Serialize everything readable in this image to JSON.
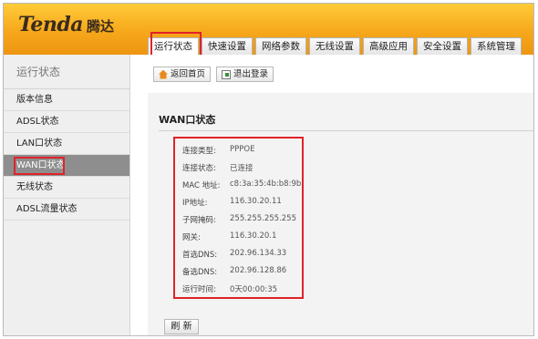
{
  "header": {
    "logo_en": "Tenda",
    "logo_cn": "腾达",
    "tabs": [
      {
        "label": "运行状态",
        "active": true
      },
      {
        "label": "快速设置",
        "active": false
      },
      {
        "label": "网络参数",
        "active": false
      },
      {
        "label": "无线设置",
        "active": false
      },
      {
        "label": "高级应用",
        "active": false
      },
      {
        "label": "安全设置",
        "active": false
      },
      {
        "label": "系统管理",
        "active": false
      }
    ]
  },
  "sidebar": {
    "title": "运行状态",
    "items": [
      {
        "label": "版本信息",
        "active": false
      },
      {
        "label": "ADSL状态",
        "active": false
      },
      {
        "label": "LAN口状态",
        "active": false
      },
      {
        "label": "WAN口状态",
        "active": true
      },
      {
        "label": "无线状态",
        "active": false
      },
      {
        "label": "ADSL流量状态",
        "active": false
      }
    ]
  },
  "toolbar": {
    "home_label": "返回首页",
    "home_icon": "home-icon",
    "logout_label": "退出登录",
    "logout_icon": "logout-icon"
  },
  "wan_status": {
    "title": "WAN口状态",
    "rows": [
      {
        "label": "连接类型:",
        "value": "PPPOE"
      },
      {
        "label": "连接状态:",
        "value": "已连接"
      },
      {
        "label": "MAC 地址:",
        "value": "c8:3a:35:4b:b8:9b"
      },
      {
        "label": "IP地址:",
        "value": "116.30.20.11"
      },
      {
        "label": "子网掩码:",
        "value": "255.255.255.255"
      },
      {
        "label": "网关:",
        "value": "116.30.20.1"
      },
      {
        "label": "首选DNS:",
        "value": "202.96.134.33"
      },
      {
        "label": "备选DNS:",
        "value": "202.96.128.86"
      },
      {
        "label": "运行时间:",
        "value": "0天00:00:35"
      }
    ],
    "refresh_label": "刷 新"
  },
  "colors": {
    "header_top": "#ffcb3a",
    "header_bottom": "#ee9512",
    "highlight": "#e0232a",
    "sidebar_active": "#8e8e8e"
  }
}
